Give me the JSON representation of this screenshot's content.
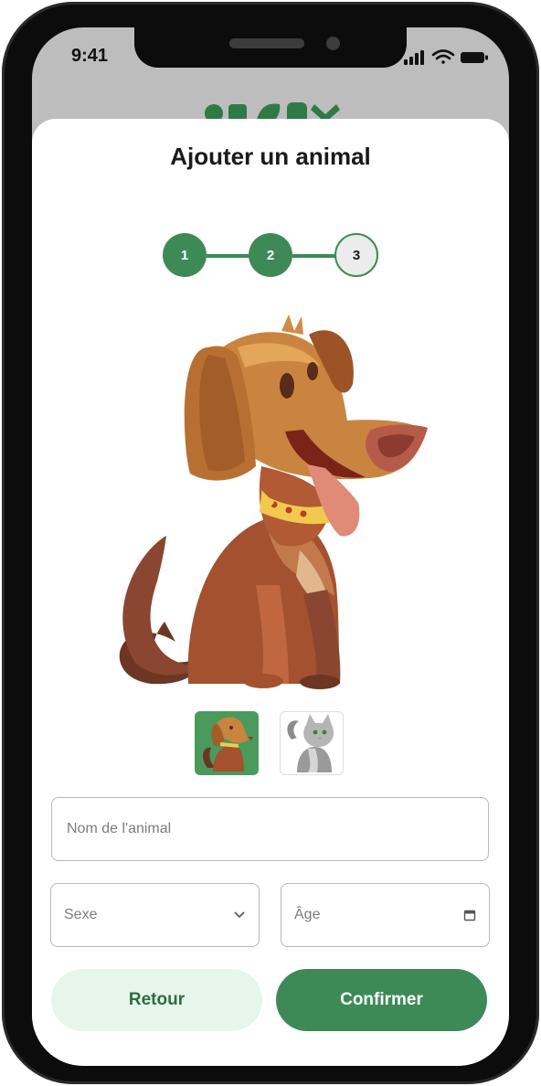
{
  "status_bar": {
    "time": "9:41"
  },
  "page": {
    "title": "Ajouter un animal"
  },
  "stepper": {
    "steps": [
      {
        "label": "1",
        "state": "done"
      },
      {
        "label": "2",
        "state": "done"
      },
      {
        "label": "3",
        "state": "current"
      }
    ]
  },
  "animal_choices": [
    {
      "name": "dog",
      "selected": true
    },
    {
      "name": "cat",
      "selected": false
    }
  ],
  "form": {
    "name_placeholder": "Nom de l'animal",
    "sex_placeholder": "Sexe",
    "age_placeholder": "Âge"
  },
  "buttons": {
    "back": "Retour",
    "confirm": "Confirmer"
  },
  "colors": {
    "primary": "#3d8a57",
    "primary_light": "#e7f6ea",
    "header_bg": "#bdbdbd"
  }
}
